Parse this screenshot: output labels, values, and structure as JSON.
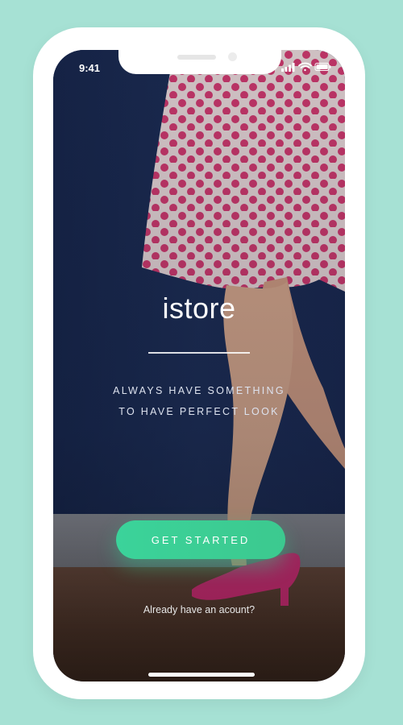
{
  "status_bar": {
    "time": "9:41",
    "icons": [
      "signal-icon",
      "wifi-icon",
      "battery-icon"
    ]
  },
  "app": {
    "name": "istore",
    "tagline_line1": "ALWAYS HAVE SOMETHING",
    "tagline_line2": "TO HAVE PERFECT LOOK"
  },
  "actions": {
    "get_started_label": "GET STARTED",
    "login_link": "Already have an acount?"
  },
  "colors": {
    "background": "#a6e1d4",
    "accent": "#3cc98f",
    "wall": "#1d2d55",
    "skirt_dots": "#d9396f",
    "shoes": "#e0307c"
  }
}
